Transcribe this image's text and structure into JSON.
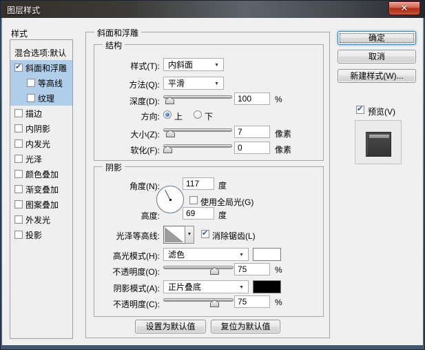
{
  "window": {
    "title": "图层样式",
    "close_glyph": "✕"
  },
  "sidebar": {
    "header": "样式",
    "items": [
      {
        "label": "混合选项:默认",
        "checkbox": false,
        "checked": false,
        "selected": false
      },
      {
        "label": "斜面和浮雕",
        "checkbox": true,
        "checked": true,
        "selected": true
      },
      {
        "label": "等高线",
        "checkbox": true,
        "checked": false,
        "selected": true
      },
      {
        "label": "纹理",
        "checkbox": true,
        "checked": false,
        "selected": true
      },
      {
        "label": "描边",
        "checkbox": true,
        "checked": false,
        "selected": false
      },
      {
        "label": "内阴影",
        "checkbox": true,
        "checked": false,
        "selected": false
      },
      {
        "label": "内发光",
        "checkbox": true,
        "checked": false,
        "selected": false
      },
      {
        "label": "光泽",
        "checkbox": true,
        "checked": false,
        "selected": false
      },
      {
        "label": "颜色叠加",
        "checkbox": true,
        "checked": false,
        "selected": false
      },
      {
        "label": "渐变叠加",
        "checkbox": true,
        "checked": false,
        "selected": false
      },
      {
        "label": "图案叠加",
        "checkbox": true,
        "checked": false,
        "selected": false
      },
      {
        "label": "外发光",
        "checkbox": true,
        "checked": false,
        "selected": false
      },
      {
        "label": "投影",
        "checkbox": true,
        "checked": false,
        "selected": false
      }
    ]
  },
  "panel": {
    "title": "斜面和浮雕",
    "structure": {
      "title": "结构",
      "style_label": "样式(T):",
      "style_value": "内斜面",
      "method_label": "方法(Q):",
      "method_value": "平滑",
      "depth_label": "深度(D):",
      "depth_value": "100",
      "depth_unit": "%",
      "direction_label": "方向:",
      "direction_up": "上",
      "direction_down": "下",
      "size_label": "大小(Z):",
      "size_value": "7",
      "size_unit": "像素",
      "soften_label": "软化(F):",
      "soften_value": "0",
      "soften_unit": "像素"
    },
    "shading": {
      "title": "阴影",
      "angle_label": "角度(N):",
      "angle_value": "117",
      "angle_unit": "度",
      "global_light_label": "使用全局光(G)",
      "global_light_checked": false,
      "altitude_label": "高度:",
      "altitude_value": "69",
      "altitude_unit": "度",
      "gloss_contour_label": "光泽等高线:",
      "antialias_label": "消除锯齿(L)",
      "antialias_checked": true,
      "highlight_mode_label": "高光模式(H):",
      "highlight_mode_value": "滤色",
      "highlight_opacity_label": "不透明度(O):",
      "highlight_opacity_value": "75",
      "highlight_opacity_unit": "%",
      "shadow_mode_label": "阴影模式(A):",
      "shadow_mode_value": "正片叠底",
      "shadow_opacity_label": "不透明度(C):",
      "shadow_opacity_value": "75",
      "shadow_opacity_unit": "%"
    },
    "footer_buttons": {
      "set_default": "设置为默认值",
      "reset_default": "复位为默认值"
    }
  },
  "actions": {
    "ok": "确定",
    "cancel": "取消",
    "new_style": "新建样式(W)...",
    "preview": "预览(V)",
    "preview_checked": true
  },
  "colors": {
    "selection_blue": "#b0cde9",
    "highlight_swatch": "#ffffff",
    "shadow_swatch": "#000000",
    "close_button_red": "#b02c1a",
    "titlebar_dark": "#3b3a37"
  }
}
